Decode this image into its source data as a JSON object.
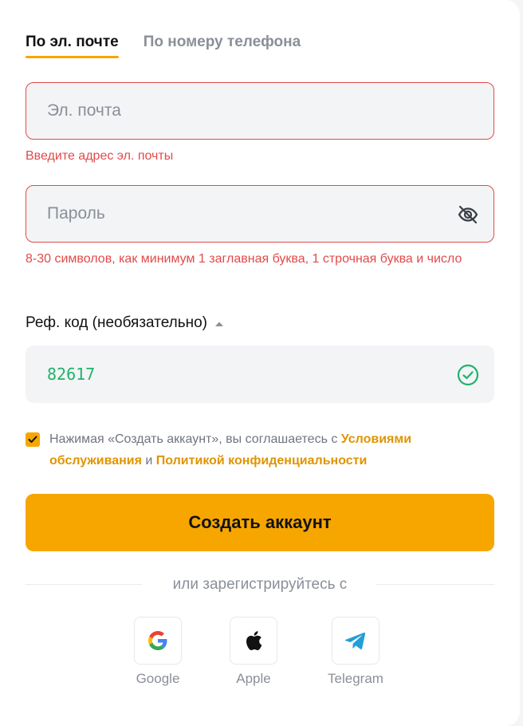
{
  "tabs": [
    {
      "label": "По эл. почте",
      "active": true
    },
    {
      "label": "По номеру телефона",
      "active": false
    }
  ],
  "email": {
    "placeholder": "Эл. почта",
    "value": "",
    "error": "Введите адрес эл. почты"
  },
  "password": {
    "placeholder": "Пароль",
    "value": "",
    "error": "8-30 символов, как минимум 1 заглавная буква, 1 строчная буква и число",
    "icon": "eye-off-icon"
  },
  "referral": {
    "toggle_label": "Реф. код (необязательно)",
    "expanded": true,
    "value": "82617",
    "status_icon": "check-circle-icon"
  },
  "consent": {
    "checked": true,
    "text_before": "Нажимая «Создать аккаунт», вы соглашаетесь с ",
    "terms_link": "Условиями обслуживания",
    "text_middle": " и ",
    "privacy_link": "Политикой конфиденциальности"
  },
  "submit_label": "Создать аккаунт",
  "divider_text": "или зарегистрируйтесь с",
  "social": [
    {
      "label": "Google",
      "icon": "google-icon"
    },
    {
      "label": "Apple",
      "icon": "apple-icon"
    },
    {
      "label": "Telegram",
      "icon": "telegram-icon"
    }
  ],
  "colors": {
    "accent": "#f7a600",
    "link": "#e09400",
    "error": "#e24a4a",
    "success": "#20b26c",
    "muted": "#8a8f98"
  }
}
